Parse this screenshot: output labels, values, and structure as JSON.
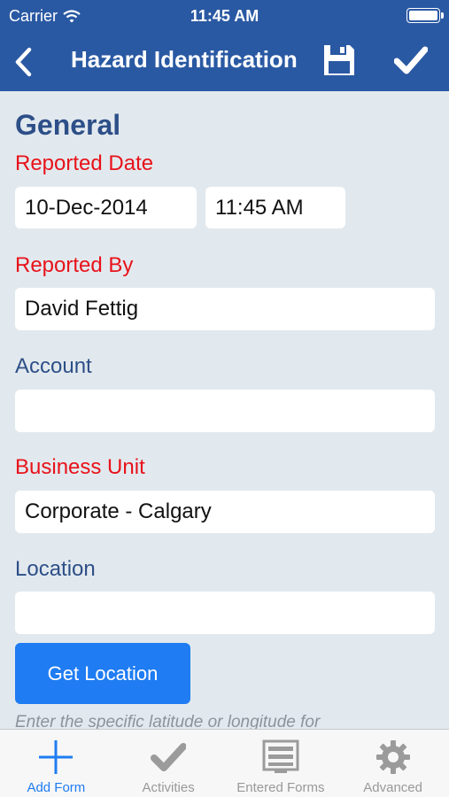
{
  "status_bar": {
    "carrier": "Carrier",
    "time": "11:45 AM"
  },
  "nav": {
    "title": "Hazard Identification",
    "back_icon": "chevron-left-icon",
    "save_icon": "floppy-disk-icon",
    "submit_icon": "checkmark-icon"
  },
  "form": {
    "section_title": "General",
    "reported_date": {
      "label": "Reported Date",
      "date": "10-Dec-2014",
      "time": "11:45 AM"
    },
    "reported_by": {
      "label": "Reported By",
      "value": "David Fettig"
    },
    "account": {
      "label": "Account",
      "value": ""
    },
    "business_unit": {
      "label": "Business Unit",
      "value": "Corporate - Calgary"
    },
    "location": {
      "label": "Location",
      "value": ""
    },
    "get_location_label": "Get Location",
    "hint": "Enter the specific latitude or longitude for"
  },
  "tabbar": {
    "tabs": [
      {
        "label": "Add Form",
        "icon": "plus-icon",
        "active": true
      },
      {
        "label": "Activities",
        "icon": "checkmark-icon",
        "active": false
      },
      {
        "label": "Entered Forms",
        "icon": "forms-list-icon",
        "active": false
      },
      {
        "label": "Advanced",
        "icon": "gear-icon",
        "active": false
      }
    ]
  },
  "colors": {
    "header": "#2a59a3",
    "required_label": "#e8121a",
    "optional_label": "#2d4f88",
    "accent": "#1f7cf2",
    "background": "#e2e9ee"
  }
}
